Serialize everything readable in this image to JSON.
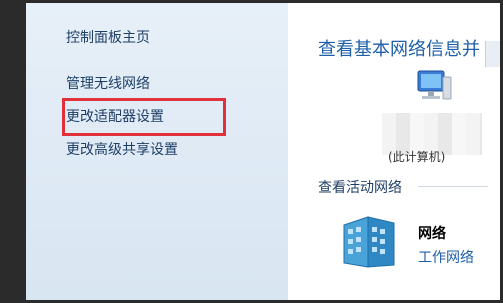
{
  "sidebar": {
    "items": [
      {
        "label": "控制面板主页"
      },
      {
        "label": "管理无线网络"
      },
      {
        "label": "更改适配器设置"
      },
      {
        "label": "更改高级共享设置"
      }
    ]
  },
  "main": {
    "title": "查看基本网络信息并",
    "computer_caption": "(此计算机)",
    "active_networks_label": "查看活动网络",
    "network": {
      "name": "网络",
      "type": "工作网络"
    }
  },
  "colors": {
    "highlight_border": "#e0313a",
    "link": "#1e5fa8",
    "sidebar_bg": "#e3edf7"
  },
  "icons": {
    "computer": "computer-icon",
    "network": "network-building-icon"
  }
}
